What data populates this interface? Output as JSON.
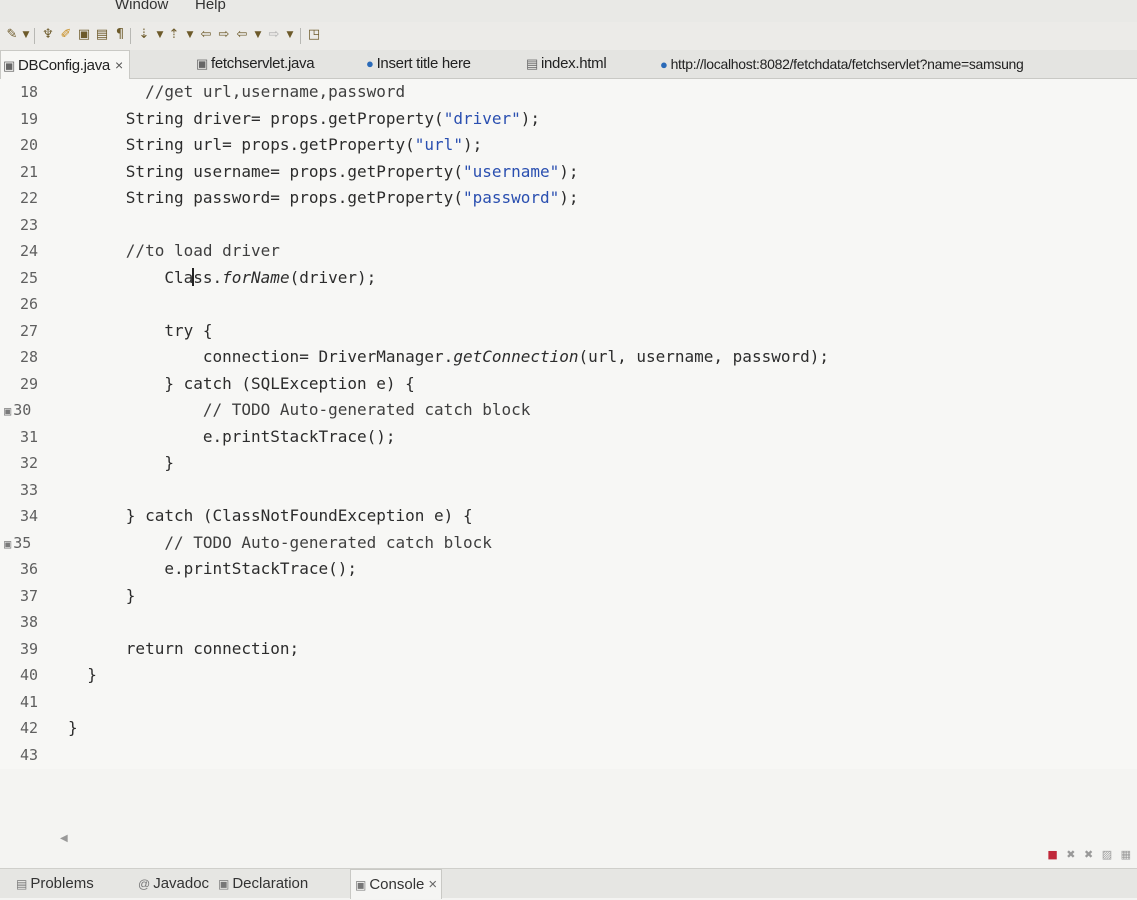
{
  "menubar": {
    "items": [
      "Window",
      "Help"
    ]
  },
  "tabs": [
    {
      "label": "DBConfig.java",
      "icon": "java-file-icon",
      "active": true,
      "close": "×"
    },
    {
      "label": "fetchservlet.java",
      "icon": "java-file-icon",
      "active": false
    },
    {
      "label": "Insert title here",
      "icon": "globe-icon",
      "active": false
    },
    {
      "label": "index.html",
      "icon": "html-file-icon",
      "active": false
    },
    {
      "label": "http://localhost:8082/fetchdata/fetchservlet?name=samsung",
      "icon": "globe-icon",
      "active": false
    }
  ],
  "editor": {
    "lines": [
      {
        "n": "18",
        "text": "        //get url,username,password"
      },
      {
        "n": "19",
        "text": "      String driver= props.getProperty(\"driver\");"
      },
      {
        "n": "20",
        "text": "      String url= props.getProperty(\"url\");"
      },
      {
        "n": "21",
        "text": "      String username= props.getProperty(\"username\");"
      },
      {
        "n": "22",
        "text": "      String password= props.getProperty(\"password\");"
      },
      {
        "n": "23",
        "text": ""
      },
      {
        "n": "24",
        "text": "      //to load driver"
      },
      {
        "n": "25",
        "text": "          Class.forName(driver);"
      },
      {
        "n": "26",
        "text": ""
      },
      {
        "n": "27",
        "text": "          try {"
      },
      {
        "n": "28",
        "text": "              connection= DriverManager.getConnection(url, username, password);"
      },
      {
        "n": "29",
        "text": "          } catch (SQLException e) {"
      },
      {
        "n": "30",
        "text": "              // TODO Auto-generated catch block"
      },
      {
        "n": "31",
        "text": "              e.printStackTrace();"
      },
      {
        "n": "32",
        "text": "          }"
      },
      {
        "n": "33",
        "text": ""
      },
      {
        "n": "34",
        "text": "      } catch (ClassNotFoundException e) {"
      },
      {
        "n": "35",
        "text": "          // TODO Auto-generated catch block"
      },
      {
        "n": "36",
        "text": "          e.printStackTrace();"
      },
      {
        "n": "37",
        "text": "      }"
      },
      {
        "n": "38",
        "text": ""
      },
      {
        "n": "39",
        "text": "      return connection;"
      },
      {
        "n": "40",
        "text": "  }"
      },
      {
        "n": "41",
        "text": ""
      },
      {
        "n": "42",
        "text": "}"
      },
      {
        "n": "43",
        "text": ""
      }
    ]
  },
  "bottom_tabs": [
    {
      "label": "Problems",
      "icon": "problems-icon"
    },
    {
      "label": "Javadoc",
      "icon": "javadoc-icon"
    },
    {
      "label": "Declaration",
      "icon": "declaration-icon"
    },
    {
      "label": "Console",
      "icon": "console-icon",
      "active": true,
      "close": "×"
    }
  ]
}
